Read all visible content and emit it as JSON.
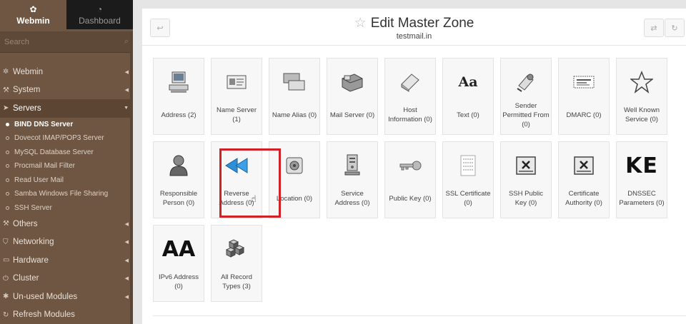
{
  "sidebar": {
    "tabs": [
      {
        "label": "Webmin",
        "icon": "webmin-logo-icon"
      },
      {
        "label": "Dashboard",
        "icon": "dashboard-icon"
      }
    ],
    "search_placeholder": "Search",
    "categories": [
      {
        "label": "Webmin",
        "icon": "gear-icon"
      },
      {
        "label": "System",
        "icon": "wrench-icon"
      },
      {
        "label": "Servers",
        "icon": "rocket-icon"
      },
      {
        "label": "Others",
        "icon": "wrench-icon"
      },
      {
        "label": "Networking",
        "icon": "shield-icon"
      },
      {
        "label": "Hardware",
        "icon": "hardware-icon"
      },
      {
        "label": "Cluster",
        "icon": "power-icon"
      },
      {
        "label": "Un-used Modules",
        "icon": "puzzle-icon"
      },
      {
        "label": "Refresh Modules",
        "icon": "refresh-icon"
      }
    ],
    "server_items": [
      "BIND DNS Server",
      "Dovecot IMAP/POP3 Server",
      "MySQL Database Server",
      "Procmail Mail Filter",
      "Read User Mail",
      "Samba Windows File Sharing",
      "SSH Server"
    ]
  },
  "header": {
    "title": "Edit Master Zone",
    "subtitle": "testmail.in"
  },
  "tiles": [
    {
      "label": "Address (2)",
      "icon": "computer-icon"
    },
    {
      "label": "Name Server (1)",
      "icon": "name-server-icon"
    },
    {
      "label": "Name Alias (0)",
      "icon": "name-alias-icon"
    },
    {
      "label": "Mail Server (0)",
      "icon": "mail-server-icon"
    },
    {
      "label": "Host Information (0)",
      "icon": "host-info-icon"
    },
    {
      "label": "Text (0)",
      "icon": "text-icon",
      "glyph": "Aa"
    },
    {
      "label": "Sender Permitted From (0)",
      "icon": "spf-icon"
    },
    {
      "label": "DMARC (0)",
      "icon": "dmarc-icon"
    },
    {
      "label": "Well Known Service (0)",
      "icon": "star-icon"
    },
    {
      "label": "Responsible Person (0)",
      "icon": "person-icon"
    },
    {
      "label": "Reverse Address (0)",
      "icon": "reverse-arrow-icon"
    },
    {
      "label": "Location (0)",
      "icon": "location-icon"
    },
    {
      "label": "Service Address (0)",
      "icon": "server-icon"
    },
    {
      "label": "Public Key (0)",
      "icon": "key-icon"
    },
    {
      "label": "SSL Certificate (0)",
      "icon": "ssl-certificate-icon"
    },
    {
      "label": "SSH Public Key (0)",
      "icon": "ssh-key-icon"
    },
    {
      "label": "Certificate Authority (0)",
      "icon": "certificate-authority-icon"
    },
    {
      "label": "DNSSEC Parameters (0)",
      "icon": "dnssec-icon",
      "glyph": "KE"
    },
    {
      "label": "IPv6 Address (0)",
      "icon": "ipv6-icon",
      "glyph": "AA"
    },
    {
      "label": "All Record Types (3)",
      "icon": "cubes-icon"
    }
  ],
  "colors": {
    "sidebar": "#6f5642",
    "highlight": "#d12026"
  }
}
